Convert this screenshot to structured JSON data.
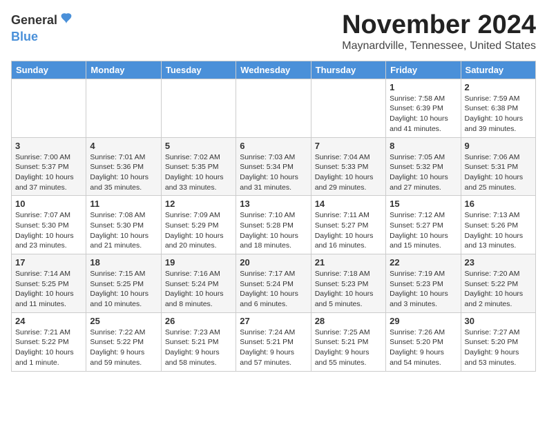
{
  "logo": {
    "general": "General",
    "blue": "Blue"
  },
  "header": {
    "month": "November 2024",
    "location": "Maynardville, Tennessee, United States"
  },
  "weekdays": [
    "Sunday",
    "Monday",
    "Tuesday",
    "Wednesday",
    "Thursday",
    "Friday",
    "Saturday"
  ],
  "weeks": [
    [
      {
        "day": "",
        "info": ""
      },
      {
        "day": "",
        "info": ""
      },
      {
        "day": "",
        "info": ""
      },
      {
        "day": "",
        "info": ""
      },
      {
        "day": "",
        "info": ""
      },
      {
        "day": "1",
        "info": "Sunrise: 7:58 AM\nSunset: 6:39 PM\nDaylight: 10 hours and 41 minutes."
      },
      {
        "day": "2",
        "info": "Sunrise: 7:59 AM\nSunset: 6:38 PM\nDaylight: 10 hours and 39 minutes."
      }
    ],
    [
      {
        "day": "3",
        "info": "Sunrise: 7:00 AM\nSunset: 5:37 PM\nDaylight: 10 hours and 37 minutes."
      },
      {
        "day": "4",
        "info": "Sunrise: 7:01 AM\nSunset: 5:36 PM\nDaylight: 10 hours and 35 minutes."
      },
      {
        "day": "5",
        "info": "Sunrise: 7:02 AM\nSunset: 5:35 PM\nDaylight: 10 hours and 33 minutes."
      },
      {
        "day": "6",
        "info": "Sunrise: 7:03 AM\nSunset: 5:34 PM\nDaylight: 10 hours and 31 minutes."
      },
      {
        "day": "7",
        "info": "Sunrise: 7:04 AM\nSunset: 5:33 PM\nDaylight: 10 hours and 29 minutes."
      },
      {
        "day": "8",
        "info": "Sunrise: 7:05 AM\nSunset: 5:32 PM\nDaylight: 10 hours and 27 minutes."
      },
      {
        "day": "9",
        "info": "Sunrise: 7:06 AM\nSunset: 5:31 PM\nDaylight: 10 hours and 25 minutes."
      }
    ],
    [
      {
        "day": "10",
        "info": "Sunrise: 7:07 AM\nSunset: 5:30 PM\nDaylight: 10 hours and 23 minutes."
      },
      {
        "day": "11",
        "info": "Sunrise: 7:08 AM\nSunset: 5:30 PM\nDaylight: 10 hours and 21 minutes."
      },
      {
        "day": "12",
        "info": "Sunrise: 7:09 AM\nSunset: 5:29 PM\nDaylight: 10 hours and 20 minutes."
      },
      {
        "day": "13",
        "info": "Sunrise: 7:10 AM\nSunset: 5:28 PM\nDaylight: 10 hours and 18 minutes."
      },
      {
        "day": "14",
        "info": "Sunrise: 7:11 AM\nSunset: 5:27 PM\nDaylight: 10 hours and 16 minutes."
      },
      {
        "day": "15",
        "info": "Sunrise: 7:12 AM\nSunset: 5:27 PM\nDaylight: 10 hours and 15 minutes."
      },
      {
        "day": "16",
        "info": "Sunrise: 7:13 AM\nSunset: 5:26 PM\nDaylight: 10 hours and 13 minutes."
      }
    ],
    [
      {
        "day": "17",
        "info": "Sunrise: 7:14 AM\nSunset: 5:25 PM\nDaylight: 10 hours and 11 minutes."
      },
      {
        "day": "18",
        "info": "Sunrise: 7:15 AM\nSunset: 5:25 PM\nDaylight: 10 hours and 10 minutes."
      },
      {
        "day": "19",
        "info": "Sunrise: 7:16 AM\nSunset: 5:24 PM\nDaylight: 10 hours and 8 minutes."
      },
      {
        "day": "20",
        "info": "Sunrise: 7:17 AM\nSunset: 5:24 PM\nDaylight: 10 hours and 6 minutes."
      },
      {
        "day": "21",
        "info": "Sunrise: 7:18 AM\nSunset: 5:23 PM\nDaylight: 10 hours and 5 minutes."
      },
      {
        "day": "22",
        "info": "Sunrise: 7:19 AM\nSunset: 5:23 PM\nDaylight: 10 hours and 3 minutes."
      },
      {
        "day": "23",
        "info": "Sunrise: 7:20 AM\nSunset: 5:22 PM\nDaylight: 10 hours and 2 minutes."
      }
    ],
    [
      {
        "day": "24",
        "info": "Sunrise: 7:21 AM\nSunset: 5:22 PM\nDaylight: 10 hours and 1 minute."
      },
      {
        "day": "25",
        "info": "Sunrise: 7:22 AM\nSunset: 5:22 PM\nDaylight: 9 hours and 59 minutes."
      },
      {
        "day": "26",
        "info": "Sunrise: 7:23 AM\nSunset: 5:21 PM\nDaylight: 9 hours and 58 minutes."
      },
      {
        "day": "27",
        "info": "Sunrise: 7:24 AM\nSunset: 5:21 PM\nDaylight: 9 hours and 57 minutes."
      },
      {
        "day": "28",
        "info": "Sunrise: 7:25 AM\nSunset: 5:21 PM\nDaylight: 9 hours and 55 minutes."
      },
      {
        "day": "29",
        "info": "Sunrise: 7:26 AM\nSunset: 5:20 PM\nDaylight: 9 hours and 54 minutes."
      },
      {
        "day": "30",
        "info": "Sunrise: 7:27 AM\nSunset: 5:20 PM\nDaylight: 9 hours and 53 minutes."
      }
    ]
  ]
}
